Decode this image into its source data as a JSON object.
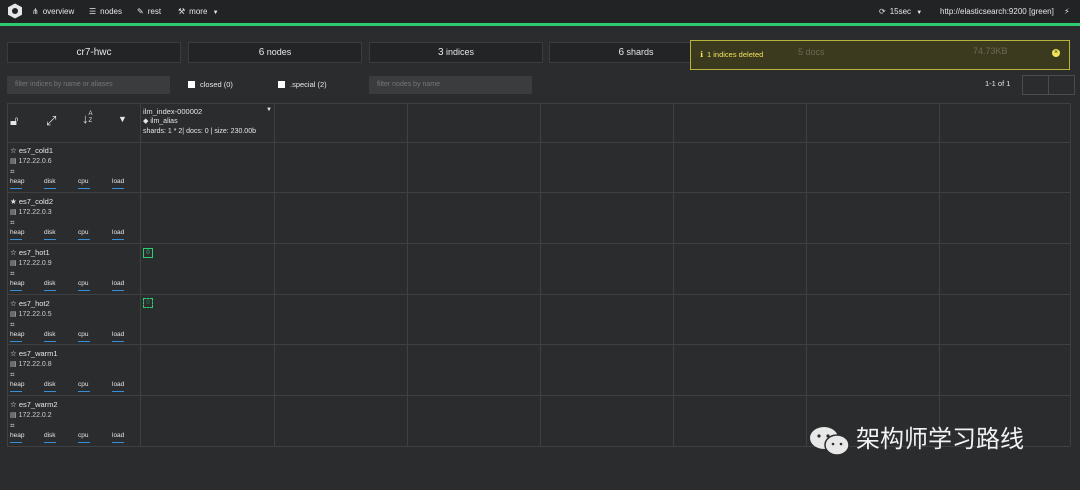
{
  "nav": {
    "overview": "overview",
    "nodes": "nodes",
    "rest": "rest",
    "more": "more",
    "refresh": "15sec",
    "cluster_url": "http://elasticsearch:9200 [green]"
  },
  "stats": {
    "cluster_name": "cr7-hwc",
    "nodes_count": "6",
    "nodes_label": "nodes",
    "indices_count": "3",
    "indices_label": "indices",
    "shards_count": "6",
    "shards_label": "shards",
    "docs_count": "5",
    "docs_label": "docs",
    "size": "74.73KB"
  },
  "alert": {
    "text": "1 indices deleted"
  },
  "filters": {
    "indices_placeholder": "filter indices by name or aliases",
    "closed_label": "closed (0)",
    "special_label": ".special (2)",
    "nodes_placeholder": "filter nodes by name"
  },
  "pagination": {
    "text": "1-1 of 1"
  },
  "index": {
    "name": "ilm_index-000002",
    "alias": "ilm_alias",
    "summary": "shards: 1 * 2| docs: 0 | size: 230.00b"
  },
  "metric_labels": [
    "heap",
    "disk",
    "cpu",
    "load"
  ],
  "nodes": [
    {
      "name": "es7_cold1",
      "ip": "172.22.0.6",
      "master": false,
      "shard": ""
    },
    {
      "name": "es7_cold2",
      "ip": "172.22.0.3",
      "master": true,
      "shard": ""
    },
    {
      "name": "es7_hot1",
      "ip": "172.22.0.9",
      "master": false,
      "shard": "0"
    },
    {
      "name": "es7_hot2",
      "ip": "172.22.0.5",
      "master": false,
      "shard": "0"
    },
    {
      "name": "es7_warm1",
      "ip": "172.22.0.8",
      "master": false,
      "shard": ""
    },
    {
      "name": "es7_warm2",
      "ip": "172.22.0.2",
      "master": false,
      "shard": ""
    }
  ],
  "watermark": {
    "text": "架构师学习路线"
  },
  "colors": {
    "accent": "#2ecc71",
    "alert_text": "#f0e35a",
    "bar": "#3a8fd6"
  }
}
